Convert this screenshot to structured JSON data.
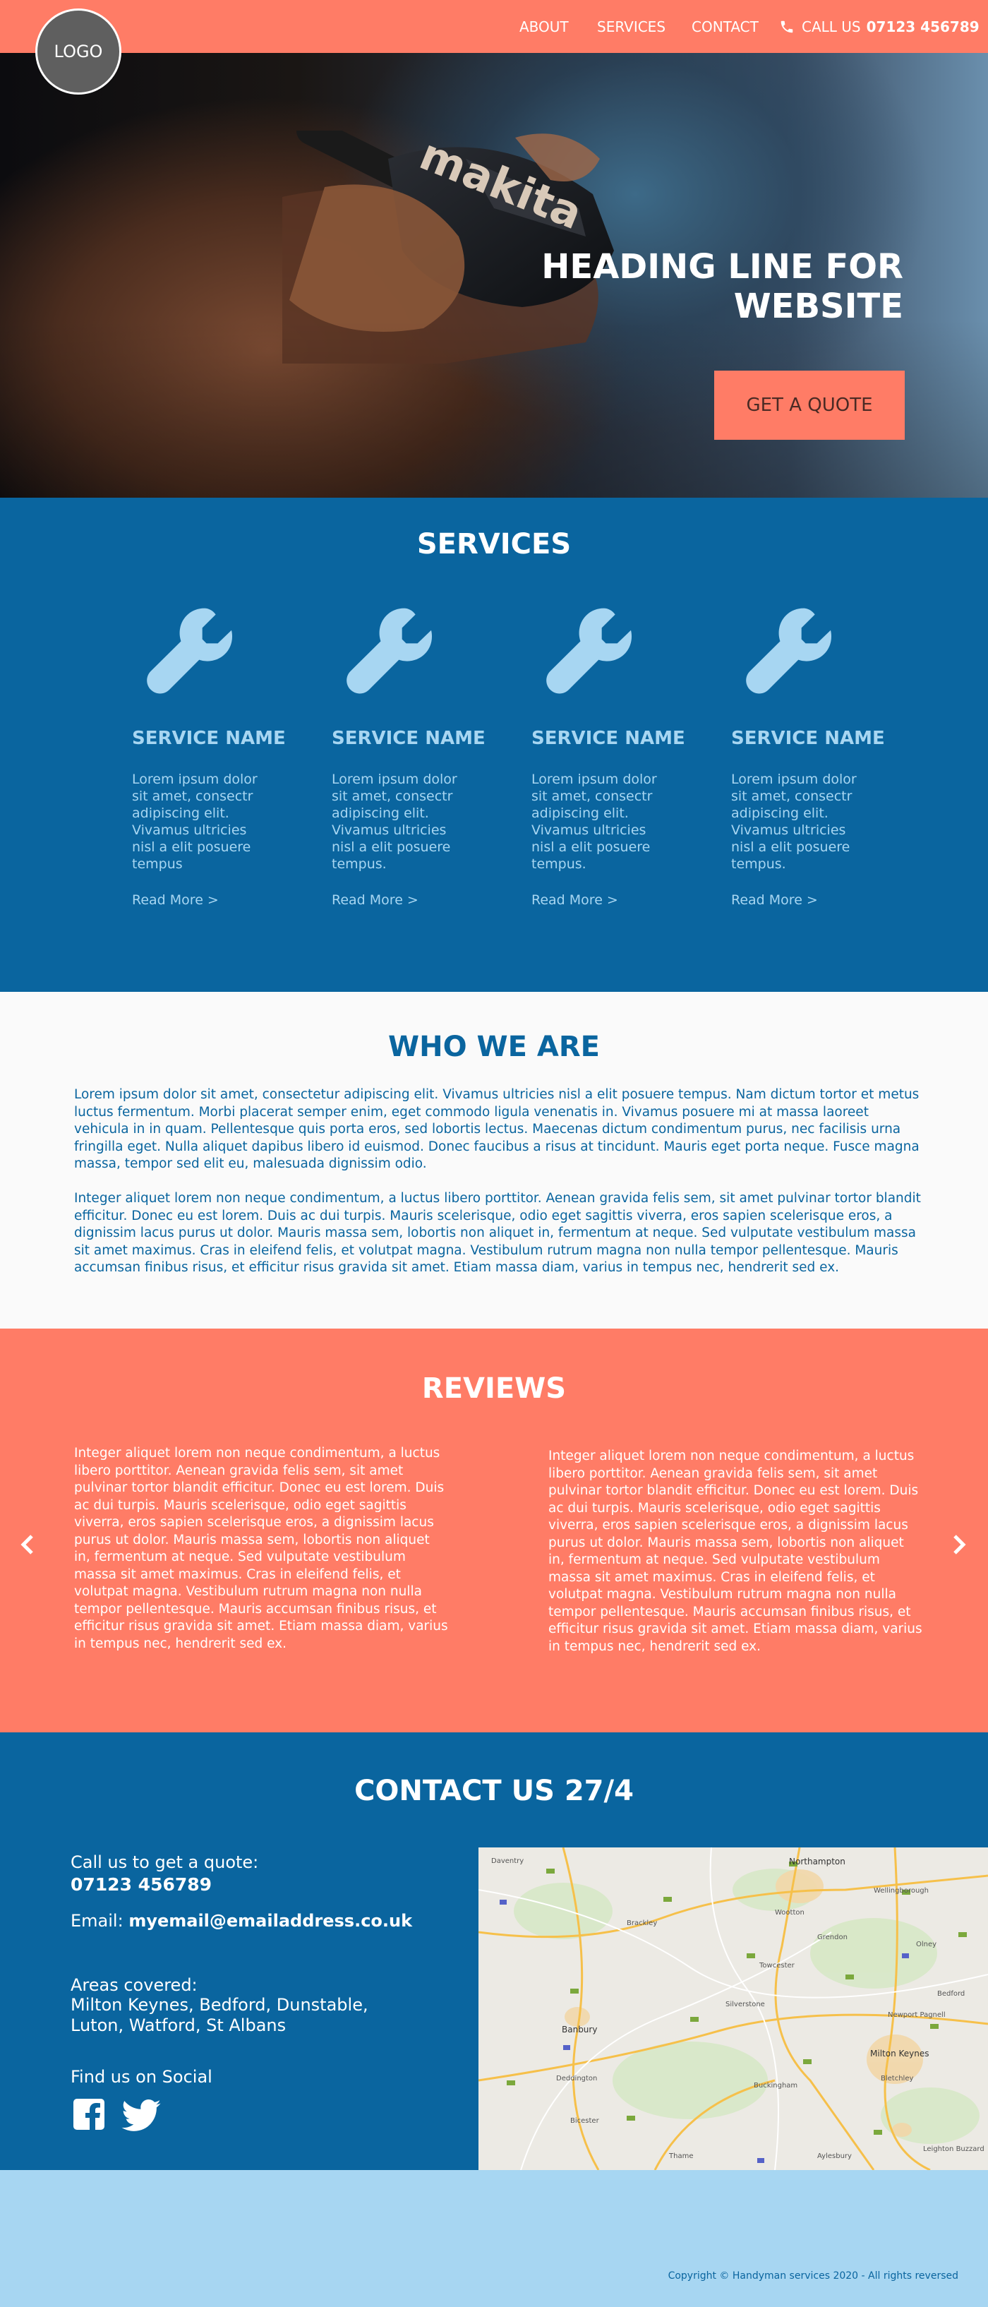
{
  "header": {
    "logo_text": "LOGO",
    "nav": [
      "ABOUT",
      "SERVICES",
      "CONTACT"
    ],
    "call_label": "CALL US",
    "phone": "07123 456789",
    "colors": {
      "bar": "#ff7c66"
    }
  },
  "hero": {
    "heading": "HEADING LINE FOR WEBSITE",
    "cta": "GET A QUOTE",
    "brand_on_tool": "makita"
  },
  "services": {
    "title": "SERVICES",
    "items": [
      {
        "icon": "wrench-icon",
        "name": "SERVICE NAME",
        "text": "Lorem ipsum dolor sit amet, consectr adipiscing elit. Vivamus ultricies nisl a elit posuere tempus",
        "link": "Read More >"
      },
      {
        "icon": "wrench-icon",
        "name": "SERVICE NAME",
        "text": "Lorem ipsum dolor sit amet, consectr adipiscing elit. Vivamus ultricies nisl a elit posuere tempus.",
        "link": "Read More >"
      },
      {
        "icon": "wrench-icon",
        "name": "SERVICE NAME",
        "text": "Lorem ipsum dolor sit amet, consectr adipiscing elit. Vivamus ultricies nisl a elit posuere tempus.",
        "link": "Read More >"
      },
      {
        "icon": "wrench-icon",
        "name": "SERVICE NAME",
        "text": "Lorem ipsum dolor sit amet, consectr adipiscing elit. Vivamus ultricies nisl a elit posuere tempus.",
        "link": "Read More >"
      }
    ],
    "colors": {
      "background": "#0a659f",
      "text": "#a7d6f2"
    }
  },
  "who": {
    "title": "WHO WE ARE",
    "p1": "Lorem ipsum dolor sit amet, consectetur adipiscing elit. Vivamus ultricies nisl a elit posuere tempus. Nam dictum tortor et metus luctus fermentum. Morbi placerat semper enim, eget commodo ligula venenatis in. Vivamus posuere mi at massa laoreet vehicula in in quam. Pellentesque quis porta eros, sed lobortis lectus. Maecenas dictum condimentum purus, nec facilisis urna fringilla eget. Nulla aliquet dapibus libero id euismod. Donec faucibus a risus at tincidunt. Mauris eget porta neque. Fusce magna massa, tempor sed elit eu, malesuada dignissim odio.",
    "p2": "Integer aliquet lorem non neque condimentum, a luctus libero porttitor. Aenean gravida felis sem, sit amet pulvinar tortor blandit efficitur. Donec eu est lorem. Duis ac dui turpis. Mauris scelerisque, odio eget sagittis viverra, eros sapien scelerisque eros, a dignissim lacus purus ut dolor. Mauris massa sem, lobortis non aliquet in, fermentum at neque. Sed vulputate vestibulum massa sit amet maximus. Cras in eleifend felis, et volutpat magna. Vestibulum rutrum magna non nulla tempor pellentesque. Mauris accumsan finibus risus, et efficitur risus gravida sit amet. Etiam massa diam, varius in tempus nec, hendrerit sed ex."
  },
  "reviews": {
    "title": "REVIEWS",
    "items": [
      "Integer aliquet lorem non neque condimentum, a luctus libero porttitor. Aenean gravida felis sem, sit amet pulvinar tortor blandit efficitur. Donec eu est lorem. Duis ac dui turpis. Mauris scelerisque, odio eget sagittis viverra, eros sapien scelerisque eros, a dignissim lacus purus ut dolor. Mauris massa sem, lobortis non aliquet in, fermentum at neque. Sed vulputate vestibulum massa sit amet maximus. Cras in eleifend felis, et volutpat magna. Vestibulum rutrum magna non nulla tempor pellentesque. Mauris accumsan finibus risus, et efficitur risus gravida sit amet. Etiam massa diam, varius in tempus nec, hendrerit sed ex.",
      "Integer aliquet lorem non neque condimentum, a luctus libero porttitor. Aenean gravida felis sem, sit amet pulvinar tortor blandit efficitur. Donec eu est lorem. Duis ac dui turpis. Mauris scelerisque, odio eget sagittis viverra, eros sapien scelerisque eros, a dignissim lacus purus ut dolor. Mauris massa sem, lobortis non aliquet in, fermentum at neque. Sed vulputate vestibulum massa sit amet maximus. Cras in eleifend felis, et volutpat magna. Vestibulum rutrum magna non nulla tempor pellentesque. Mauris accumsan finibus risus, et efficitur risus gravida sit amet. Etiam massa diam, varius in tempus nec, hendrerit sed ex."
    ],
    "prev_icon": "chevron-left-icon",
    "next_icon": "chevron-right-icon",
    "colors": {
      "background": "#ff7c66"
    }
  },
  "contact": {
    "title": "CONTACT US 27/4",
    "quote_label": "Call us to get a quote:",
    "phone": "07123 456789",
    "email_label": "Email:",
    "email": "myemail@emailaddress.co.uk",
    "areas_label": "Areas covered:",
    "areas_line1": "Milton Keynes, Bedford, Dunstable,",
    "areas_line2": "Luton, Watford, St Albans",
    "social_label": "Find us on Social",
    "social_icons": [
      "facebook-icon",
      "twitter-icon"
    ]
  },
  "map": {
    "places": [
      "Daventry",
      "Northampton",
      "Wellingborough",
      "Towcester",
      "Brackley",
      "Banbury",
      "Bicester",
      "Milton Keynes",
      "Bletchley",
      "Buckingham",
      "Newport Pagnell",
      "Olney",
      "Bedford",
      "Leighton Buzzard",
      "Aylesbury",
      "Thame",
      "Deddington",
      "Silverstone",
      "Wootton",
      "Grendon"
    ]
  },
  "footer": {
    "copyright": "Copyright © Handyman services 2020 - All rights reversed"
  }
}
